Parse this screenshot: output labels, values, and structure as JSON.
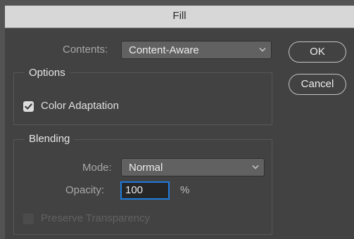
{
  "dialog": {
    "title": "Fill"
  },
  "contents": {
    "label": "Contents:",
    "value": "Content-Aware"
  },
  "buttons": {
    "ok": "OK",
    "cancel": "Cancel"
  },
  "options": {
    "title": "Options",
    "color_adaptation": {
      "label": "Color Adaptation",
      "checked": true
    }
  },
  "blending": {
    "title": "Blending",
    "mode_label": "Mode:",
    "mode_value": "Normal",
    "opacity_label": "Opacity:",
    "opacity_value": "100",
    "opacity_unit": "%",
    "preserve_transparency": {
      "label": "Preserve Transparency",
      "checked": false,
      "enabled": false
    }
  },
  "colors": {
    "focus_accent": "#1f7be0"
  },
  "icons": [
    "chevron-down-icon",
    "checkmark-icon"
  ]
}
